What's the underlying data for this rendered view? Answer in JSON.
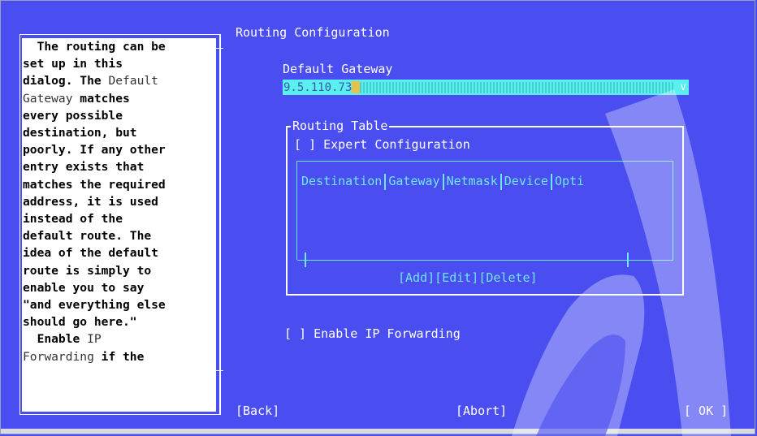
{
  "help": {
    "lines": [
      {
        "segments": [
          {
            "t": "  The routing can be",
            "b": true
          }
        ]
      },
      {
        "segments": [
          {
            "t": "set up in this",
            "b": true
          }
        ]
      },
      {
        "segments": [
          {
            "t": "dialog. The ",
            "b": true
          },
          {
            "t": "Default",
            "b": false
          }
        ]
      },
      {
        "segments": [
          {
            "t": "Gateway",
            "b": false
          },
          {
            "t": " matches",
            "b": true
          }
        ]
      },
      {
        "segments": [
          {
            "t": "every possible",
            "b": true
          }
        ]
      },
      {
        "segments": [
          {
            "t": "destination, but",
            "b": true
          }
        ]
      },
      {
        "segments": [
          {
            "t": "poorly. If any other",
            "b": true
          }
        ]
      },
      {
        "segments": [
          {
            "t": "entry exists that",
            "b": true
          }
        ]
      },
      {
        "segments": [
          {
            "t": "matches the required",
            "b": true
          }
        ]
      },
      {
        "segments": [
          {
            "t": "address, it is used",
            "b": true
          }
        ]
      },
      {
        "segments": [
          {
            "t": "instead of the",
            "b": true
          }
        ]
      },
      {
        "segments": [
          {
            "t": "default route. The",
            "b": true
          }
        ]
      },
      {
        "segments": [
          {
            "t": "idea of the default",
            "b": true
          }
        ]
      },
      {
        "segments": [
          {
            "t": "route is simply to",
            "b": true
          }
        ]
      },
      {
        "segments": [
          {
            "t": "enable you to say",
            "b": true
          }
        ]
      },
      {
        "segments": [
          {
            "t": "\"and everything else",
            "b": true
          }
        ]
      },
      {
        "segments": [
          {
            "t": "should go here.\"",
            "b": true
          }
        ]
      },
      {
        "segments": [
          {
            "t": "  Enable ",
            "b": true
          },
          {
            "t": "IP",
            "b": false
          }
        ]
      },
      {
        "segments": [
          {
            "t": "Forwarding",
            "b": false
          },
          {
            "t": " if the",
            "b": true
          }
        ]
      }
    ]
  },
  "dialog": {
    "title": "Routing Configuration",
    "gateway_label": "Default Gateway",
    "gateway_value": "9.5.110.73",
    "gateway_dropdown": "v",
    "routing_table_title": "Routing Table",
    "expert_checkbox": "[ ] Expert Configuration",
    "table_columns": [
      "Destination",
      "Gateway",
      "Netmask",
      "Device",
      "Opti"
    ],
    "table_buttons": {
      "add": "[Add]",
      "edit": "[Edit]",
      "delete": "[Delete]"
    },
    "ip_forwarding_checkbox": "[ ] Enable IP Forwarding"
  },
  "buttons": {
    "back": "[Back]",
    "abort": "[Abort]",
    "ok": "[ OK ]"
  },
  "colors": {
    "background": "#4a4ef0",
    "accent_cyan": "#6ee7ec",
    "input_bg": "#5af0f0"
  }
}
